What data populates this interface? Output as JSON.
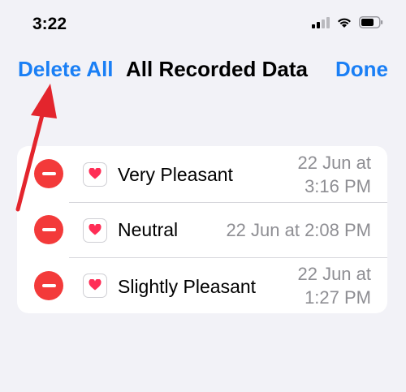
{
  "status_bar": {
    "time": "3:22",
    "icons": [
      "cellular-signal-icon",
      "wifi-icon",
      "battery-icon"
    ]
  },
  "nav": {
    "left_button": "Delete All",
    "title": "All Recorded Data",
    "right_button": "Done"
  },
  "entries": [
    {
      "label": "Very Pleasant",
      "date_line1": "22 Jun at",
      "date_line2": "3:16 PM"
    },
    {
      "label": "Neutral",
      "date_line1": "22 Jun at 2:08 PM"
    },
    {
      "label": "Slightly Pleasant",
      "date_line1": "22 Jun at",
      "date_line2": "1:27 PM"
    }
  ],
  "colors": {
    "accent": "#1a7ff5",
    "destructive": "#f33a3a",
    "annotation_arrow": "#e3252d",
    "background": "#f2f2f7",
    "heart": "#ff2d55"
  }
}
